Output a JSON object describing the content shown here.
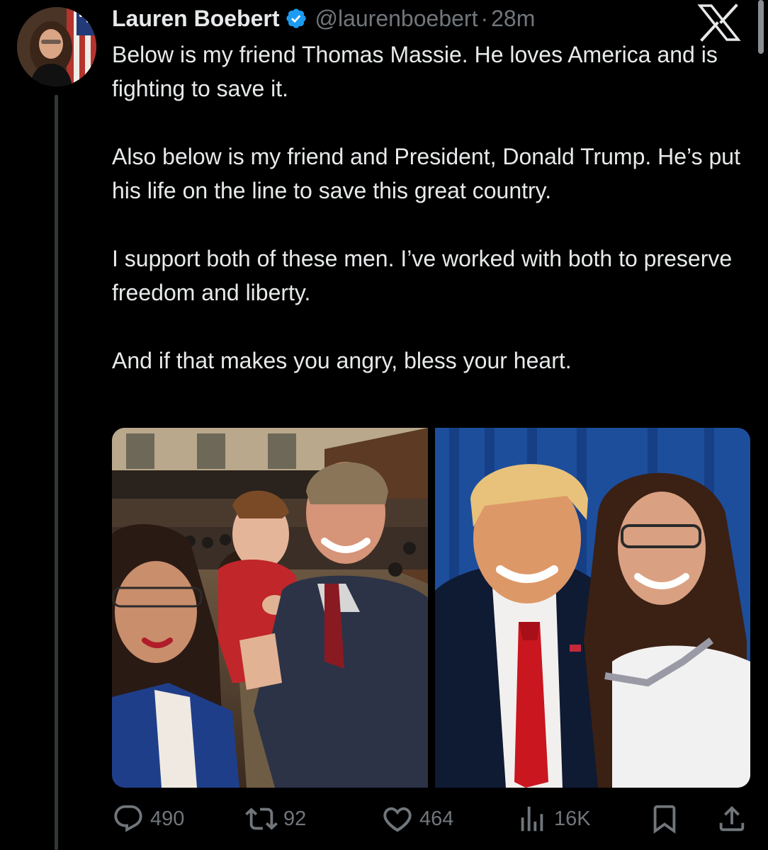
{
  "tweet": {
    "author": {
      "display_name": "Lauren Boebert",
      "handle": "@laurenboebert",
      "verified_icon": "verified-badge-icon"
    },
    "separator": "·",
    "time": "28m",
    "paragraphs": [
      "Below is my friend Thomas Massie. He loves America and is fighting to save it.",
      "Also below is my friend and President, Donald Trump. He’s put his life on the line to save this great country.",
      "I support both of these men. I’ve worked with both to preserve freedom and liberty.",
      "And if that makes you angry, bless your heart."
    ],
    "media_count": 2,
    "actions": {
      "replies": "490",
      "reposts": "92",
      "likes": "464",
      "views": "16K",
      "reply_icon": "reply-icon",
      "repost_icon": "repost-icon",
      "like_icon": "heart-icon",
      "views_icon": "views-chart-icon",
      "bookmark_icon": "bookmark-icon",
      "share_icon": "share-icon"
    }
  },
  "brand": {
    "logo": "x-logo-icon"
  },
  "colors": {
    "background": "#000000",
    "text_primary": "#e7e9ea",
    "text_secondary": "#71767b",
    "verified": "#1d9bf0",
    "thread_line": "#333639"
  }
}
